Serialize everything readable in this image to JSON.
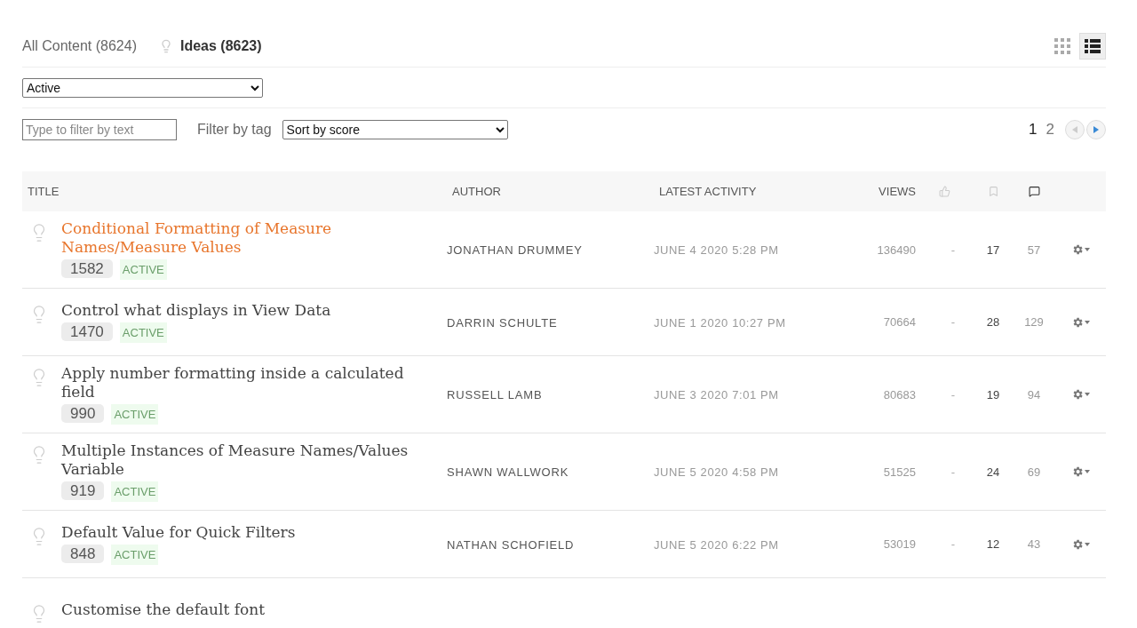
{
  "tabs": [
    {
      "label": "All Content (8624)",
      "selected": false,
      "kind": "plain"
    },
    {
      "label": "Ideas (8623)",
      "selected": true,
      "kind": "idea"
    }
  ],
  "view_toggles": [
    {
      "kind": "grid",
      "selected": false
    },
    {
      "kind": "list",
      "selected": true
    }
  ],
  "status_filter": {
    "value": "Active"
  },
  "text_filter": {
    "placeholder": "Type to filter by text"
  },
  "tag_filter": {
    "label": "Filter by tag"
  },
  "sort": {
    "value": "Sort by score"
  },
  "pagination": {
    "pages": [
      {
        "label": "1",
        "selected": true
      },
      {
        "label": "2",
        "selected": false
      }
    ],
    "prev_disabled": true,
    "next_disabled": false
  },
  "table": {
    "columns": [
      {
        "kind": "text",
        "label": "TITLE"
      },
      {
        "kind": "text",
        "label": "AUTHOR"
      },
      {
        "kind": "text",
        "label": "LATEST ACTIVITY"
      },
      {
        "kind": "text",
        "label": "VIEWS"
      },
      {
        "kind": "votes"
      },
      {
        "kind": "bookmarks"
      },
      {
        "kind": "comments"
      }
    ],
    "rows": [
      {
        "title": "Conditional Formatting of Measure Names/Measure Values",
        "highlighted": true,
        "score": "1582",
        "status": "ACTIVE",
        "author": "JONATHAN DRUMMEY",
        "activity": "JUNE 4 2020 5:28 PM",
        "views": "136490",
        "votes": "-",
        "bookmarks": "17",
        "comments": "57"
      },
      {
        "title": "Control what displays in View Data",
        "highlighted": false,
        "score": "1470",
        "status": "ACTIVE",
        "author": "DARRIN SCHULTE",
        "activity": "JUNE 1 2020 10:27 PM",
        "views": "70664",
        "votes": "-",
        "bookmarks": "28",
        "comments": "129"
      },
      {
        "title": "Apply number formatting inside a calculated field",
        "highlighted": false,
        "score": "990",
        "status": "ACTIVE",
        "author": "RUSSELL LAMB",
        "activity": "JUNE 3 2020 7:01 PM",
        "views": "80683",
        "votes": "-",
        "bookmarks": "19",
        "comments": "94"
      },
      {
        "title": "Multiple Instances of Measure Names/Values Variable",
        "highlighted": false,
        "score": "919",
        "status": "ACTIVE",
        "author": "SHAWN WALLWORK",
        "activity": "JUNE 5 2020 4:58 PM",
        "views": "51525",
        "votes": "-",
        "bookmarks": "24",
        "comments": "69"
      },
      {
        "title": "Default Value for Quick Filters",
        "highlighted": false,
        "score": "848",
        "status": "ACTIVE",
        "author": "NATHAN SCHOFIELD",
        "activity": "JUNE 5 2020 6:22 PM",
        "views": "53019",
        "votes": "-",
        "bookmarks": "12",
        "comments": "43"
      },
      {
        "title": "Customise the default font",
        "highlighted": false
      }
    ]
  }
}
